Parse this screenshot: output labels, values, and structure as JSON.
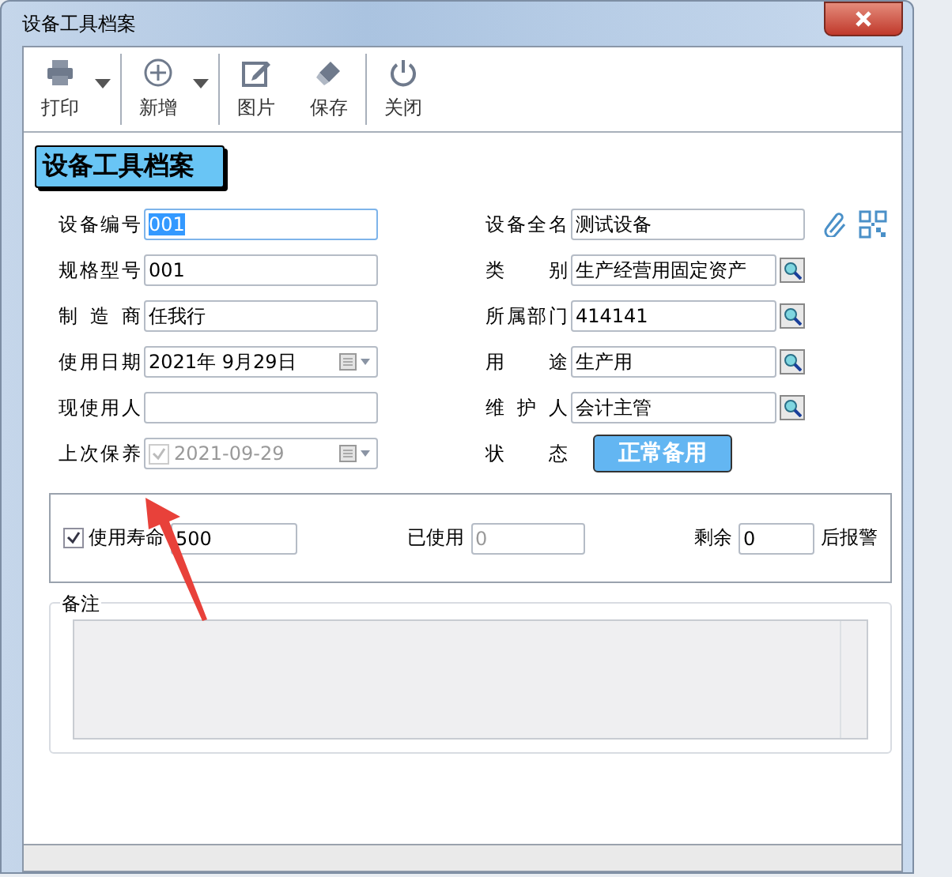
{
  "window": {
    "title": "设备工具档案"
  },
  "toolbar": [
    {
      "label": "打印",
      "dropdown": true,
      "separator_after": true
    },
    {
      "label": "新增",
      "dropdown": true,
      "separator_after": true
    },
    {
      "label": "图片",
      "dropdown": false,
      "separator_after": false
    },
    {
      "label": "保存",
      "dropdown": false,
      "separator_after": true
    },
    {
      "label": "关闭",
      "dropdown": false,
      "separator_after": false
    }
  ],
  "heading": "设备工具档案",
  "left_fields": [
    {
      "label": "设备编号",
      "kind": "text",
      "value": "001",
      "highlighted": true
    },
    {
      "label": "规格型号",
      "kind": "text",
      "value": "001",
      "highlighted": false
    },
    {
      "label": "制 造 商",
      "kind": "text",
      "value": "任我行",
      "highlighted": false
    },
    {
      "label": "使用日期",
      "kind": "date",
      "value": "2021年  9月29日",
      "disabled": false
    },
    {
      "label": "现使用人",
      "kind": "text",
      "highlighted": false
    },
    {
      "label": "上次保养",
      "kind": "check_date",
      "value": "2021-09-29",
      "checked": true,
      "disabled": true
    }
  ],
  "right_fields": [
    {
      "label": "设备全名",
      "kind": "text_icons",
      "value": "测试设备"
    },
    {
      "label": "类 别",
      "kind": "lookup",
      "value": "生产经营用固定资产"
    },
    {
      "label": "所属部门",
      "kind": "lookup",
      "value": "414141"
    },
    {
      "label": "用 途",
      "kind": "lookup",
      "value": "生产用"
    },
    {
      "label": "维 护 人",
      "kind": "lookup",
      "value": "会计主管"
    },
    {
      "label": "状 态",
      "kind": "status",
      "value": "正常备用"
    }
  ],
  "life": {
    "checked": true,
    "label": "使用寿命",
    "value": "500",
    "used_label": "已使用",
    "used_value": "0",
    "remain_label": "剩余",
    "remain_value": "0",
    "suffix": "后报警"
  },
  "remarks": {
    "label": "备注"
  }
}
